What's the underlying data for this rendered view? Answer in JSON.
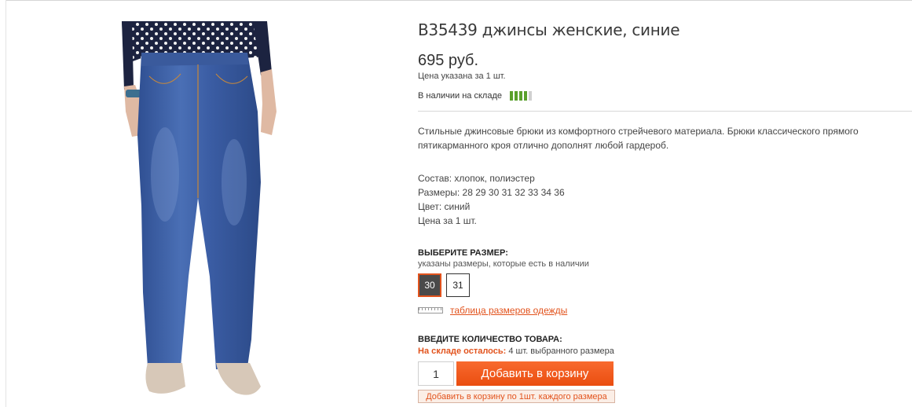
{
  "product": {
    "title": "B35439 джинсы женские, синие",
    "price": "695 руб.",
    "price_note": "Цена указана за 1 шт.",
    "stock_label": "В наличии на складе",
    "stock_level": 0.8,
    "description": "Стильные джинсовые брюки из комфортного стрейчевого материала. Брюки классического прямого пятикарманного кроя отлично дополнят любой гардероб.",
    "specs": [
      "Состав:  хлопок, полиэстер",
      "Размеры: 28 29 30 31 32 33 34 36",
      "Цвет: синий",
      "Цена за 1 шт."
    ]
  },
  "size_select": {
    "heading": "ВЫБЕРИТЕ РАЗМЕР:",
    "subheading": "указаны размеры, которые есть в наличии",
    "options": [
      "30",
      "31"
    ],
    "selected": "30",
    "size_table_link": "таблица размеров одежды"
  },
  "quantity": {
    "heading": "ВВЕДИТЕ КОЛИЧЕСТВО ТОВАРА:",
    "stock_warn": "На складе осталось:",
    "stock_rest": "4 шт. выбранного размера",
    "value": "1",
    "add_button": "Добавить в корзину",
    "add_each_button": "Добавить в корзину по 1шт. каждого размера"
  },
  "colors": {
    "accent": "#e2531d",
    "stock_on": "#5aa02c",
    "stock_off": "#d0d0d0"
  }
}
